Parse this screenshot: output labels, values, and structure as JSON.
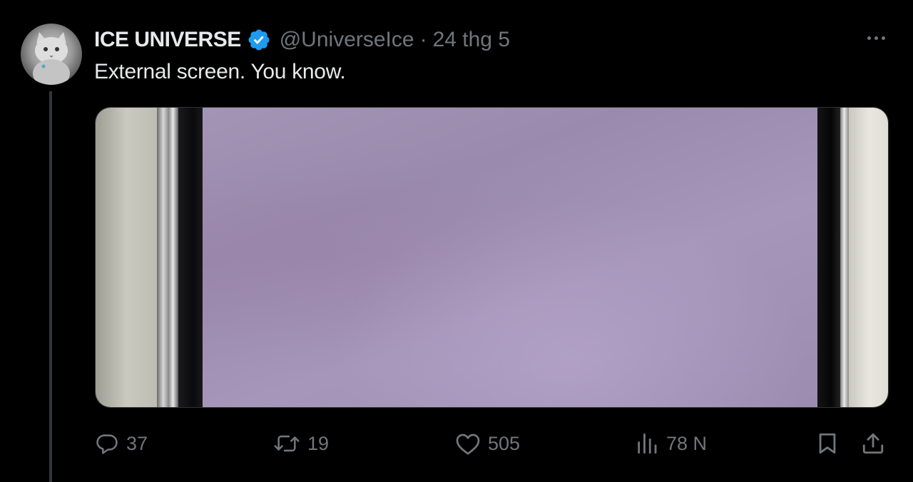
{
  "author": {
    "name": "ICE UNIVERSE",
    "handle": "@UniverseIce",
    "separator": "·",
    "date": "24 thg 5",
    "verified": true,
    "verified_color": "#1d9bf0",
    "avatar_icon": "cat-avatar"
  },
  "tweet": {
    "text": "External screen. You know."
  },
  "media": {
    "icon": "photo-of-phone-external-screen",
    "screen_color": "#a394b6"
  },
  "actions": {
    "reply": {
      "icon": "reply-icon",
      "count": "37"
    },
    "retweet": {
      "icon": "retweet-icon",
      "count": "19"
    },
    "like": {
      "icon": "heart-icon",
      "count": "505"
    },
    "views": {
      "icon": "views-icon",
      "count": "78 N"
    },
    "bookmark": {
      "icon": "bookmark-icon"
    },
    "share": {
      "icon": "share-icon"
    }
  },
  "colors": {
    "background": "#000000",
    "text": "#e7e9ea",
    "muted": "#71767b",
    "thread_line": "#333639"
  }
}
